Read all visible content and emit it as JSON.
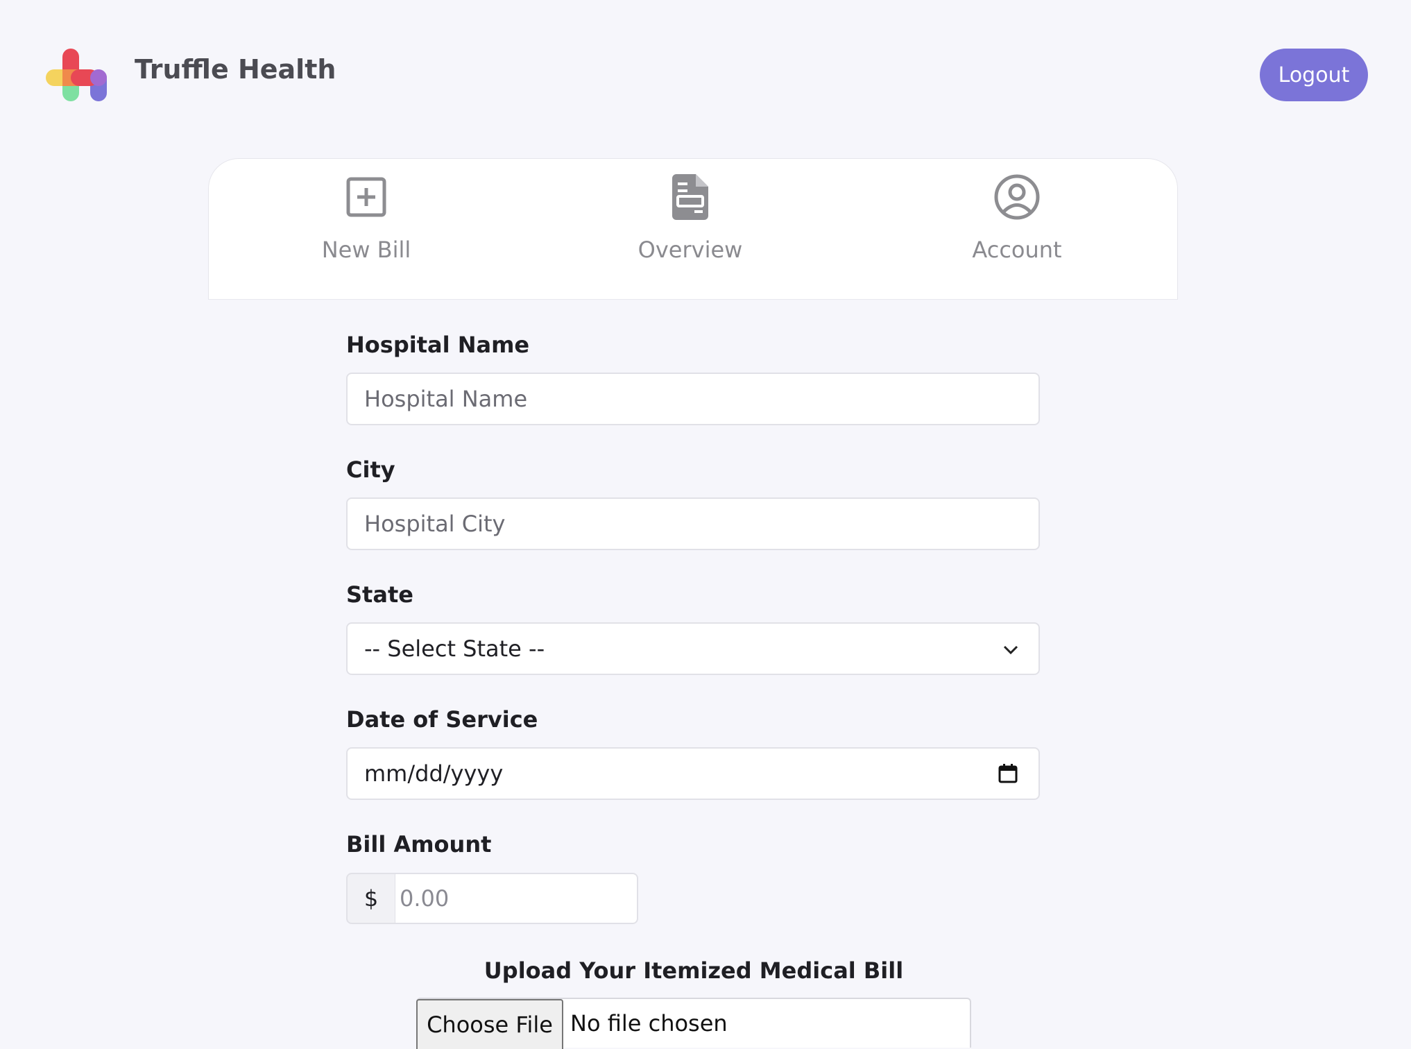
{
  "header": {
    "brand_name": "Truffle Health",
    "logout_label": "Logout",
    "logo_colors": [
      "#f4d35e",
      "#e84855",
      "#7ee0a1",
      "#7b74d8"
    ],
    "accent_color": "#7b74d8"
  },
  "tabs": [
    {
      "label": "New Bill",
      "icon": "plus-square-icon"
    },
    {
      "label": "Overview",
      "icon": "document-icon"
    },
    {
      "label": "Account",
      "icon": "user-circle-icon"
    }
  ],
  "form": {
    "hospital_name": {
      "label": "Hospital Name",
      "placeholder": "Hospital Name",
      "value": ""
    },
    "city": {
      "label": "City",
      "placeholder": "Hospital City",
      "value": ""
    },
    "state": {
      "label": "State",
      "selected": "-- Select State --",
      "icon": "chevron-down-icon"
    },
    "date_of_service": {
      "label": "Date of Service",
      "placeholder": "mm/dd/yyyy",
      "icon": "calendar-icon"
    },
    "bill_amount": {
      "label": "Bill Amount",
      "prefix": "$",
      "placeholder": "0.00"
    },
    "upload": {
      "title": "Upload Your Itemized Medical Bill",
      "button_label": "Choose File",
      "status": "No file chosen"
    }
  }
}
